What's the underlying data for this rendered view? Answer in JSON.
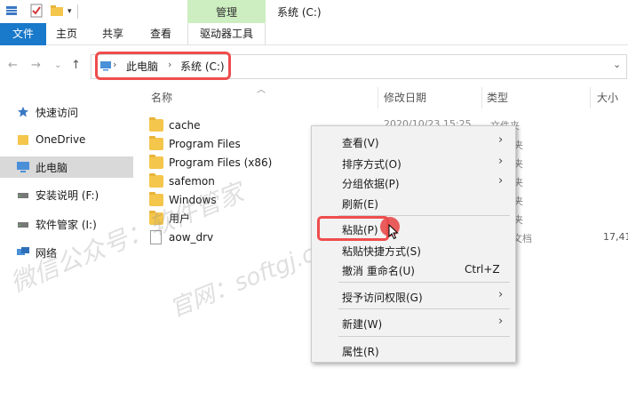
{
  "titlebar": {
    "manage_label": "管理",
    "window_title": "系统 (C:)"
  },
  "ribbon": {
    "file": "文件",
    "home": "主页",
    "share": "共享",
    "view": "查看",
    "drive_tools": "驱动器工具"
  },
  "address": {
    "crumbs": [
      "此电脑",
      "系统 (C:)"
    ]
  },
  "sidebar": {
    "items": [
      {
        "label": "快速访问",
        "icon": "star-icon"
      },
      {
        "label": "OneDrive",
        "icon": "folder-icon"
      },
      {
        "label": "此电脑",
        "icon": "computer-icon"
      },
      {
        "label": "安装说明 (F:)",
        "icon": "drive-icon"
      },
      {
        "label": "软件管家 (I:)",
        "icon": "drive-icon"
      },
      {
        "label": "网络",
        "icon": "network-icon"
      }
    ]
  },
  "columns": {
    "name": "名称",
    "date": "修改日期",
    "type": "类型",
    "size": "大小"
  },
  "files": [
    {
      "name": "cache",
      "kind": "folder"
    },
    {
      "name": "Program Files",
      "kind": "folder"
    },
    {
      "name": "Program Files (x86)",
      "kind": "folder"
    },
    {
      "name": "safemon",
      "kind": "folder"
    },
    {
      "name": "Windows",
      "kind": "folder"
    },
    {
      "name": "用户",
      "kind": "folder"
    },
    {
      "name": "aow_drv",
      "kind": "file"
    }
  ],
  "file_meta": {
    "cache_date": "2020/10/23 15:25",
    "cache_type": "文件夹",
    "aow_type_partial": "文档",
    "aow_size_partial": "17,41",
    "type_partial": "夹"
  },
  "context_menu": {
    "items": [
      {
        "label": "查看(V)",
        "submenu": true
      },
      {
        "label": "排序方式(O)",
        "submenu": true
      },
      {
        "label": "分组依据(P)",
        "submenu": true
      },
      {
        "label": "刷新(E)"
      },
      {
        "label": "粘贴(P)"
      },
      {
        "label": "粘贴快捷方式(S)"
      },
      {
        "label": "撤消 重命名(U)",
        "shortcut": "Ctrl+Z"
      },
      {
        "label": "授予访问权限(G)",
        "submenu": true
      },
      {
        "label": "新建(W)",
        "submenu": true
      },
      {
        "label": "属性(R)"
      }
    ]
  },
  "watermark": {
    "line1": "微信公众号：软件管家",
    "line2": "官网：softgj.com"
  },
  "colors": {
    "file_tab": "#1979ca",
    "manage_tab": "#cdeec0",
    "highlight_red": "#ef4d4d",
    "folder": "#f4c64b"
  }
}
